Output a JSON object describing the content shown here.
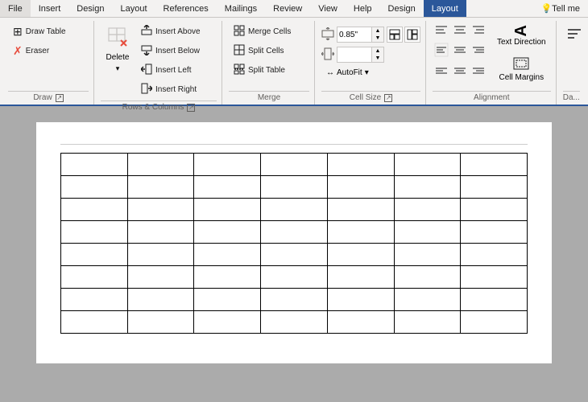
{
  "menubar": {
    "items": [
      {
        "id": "file",
        "label": "File"
      },
      {
        "id": "insert",
        "label": "Insert"
      },
      {
        "id": "design",
        "label": "Design"
      },
      {
        "id": "layout-menu",
        "label": "Layout"
      },
      {
        "id": "references",
        "label": "References"
      },
      {
        "id": "mailings",
        "label": "Mailings"
      },
      {
        "id": "review",
        "label": "Review"
      },
      {
        "id": "view",
        "label": "View"
      },
      {
        "id": "help",
        "label": "Help"
      },
      {
        "id": "design2",
        "label": "Design"
      },
      {
        "id": "layout-active",
        "label": "Layout",
        "active": true
      }
    ],
    "help_label": "Tell me"
  },
  "ribbon": {
    "groups": {
      "draw": {
        "label": "Draw",
        "draw_table": "Draw Table",
        "eraser": "Eraser"
      },
      "rows_columns": {
        "label": "Rows & Columns",
        "delete": "Delete",
        "insert_above": "Insert Above",
        "insert_below": "Insert Below",
        "insert_left": "Insert Left",
        "insert_right": "Insert Right"
      },
      "merge": {
        "label": "Merge",
        "merge_cells": "Merge Cells",
        "split_cells": "Split Cells",
        "split_table": "Split Table"
      },
      "cell_size": {
        "label": "Cell Size",
        "height_label": "",
        "height_value": "0.85\"",
        "width_label": "",
        "autofit": "AutoFit"
      },
      "alignment": {
        "label": "Alignment",
        "text_direction": "Text Direction",
        "cell_margins": "Cell Margins"
      }
    }
  },
  "table": {
    "rows": 8,
    "cols": 7
  },
  "icons": {
    "draw_table": "⊞",
    "eraser": "⌫",
    "delete": "✕",
    "insert_above": "⬆",
    "insert_below": "⬇",
    "insert_left": "⬅",
    "insert_right": "➡",
    "merge_cells": "⊠",
    "split_cells": "⊟",
    "split_table": "⊞",
    "autofit": "↔",
    "text_direction": "A",
    "cell_margins": "⊡",
    "data": "📊",
    "dropdown": "▾",
    "align_tl": "≡",
    "expand": "↗"
  }
}
